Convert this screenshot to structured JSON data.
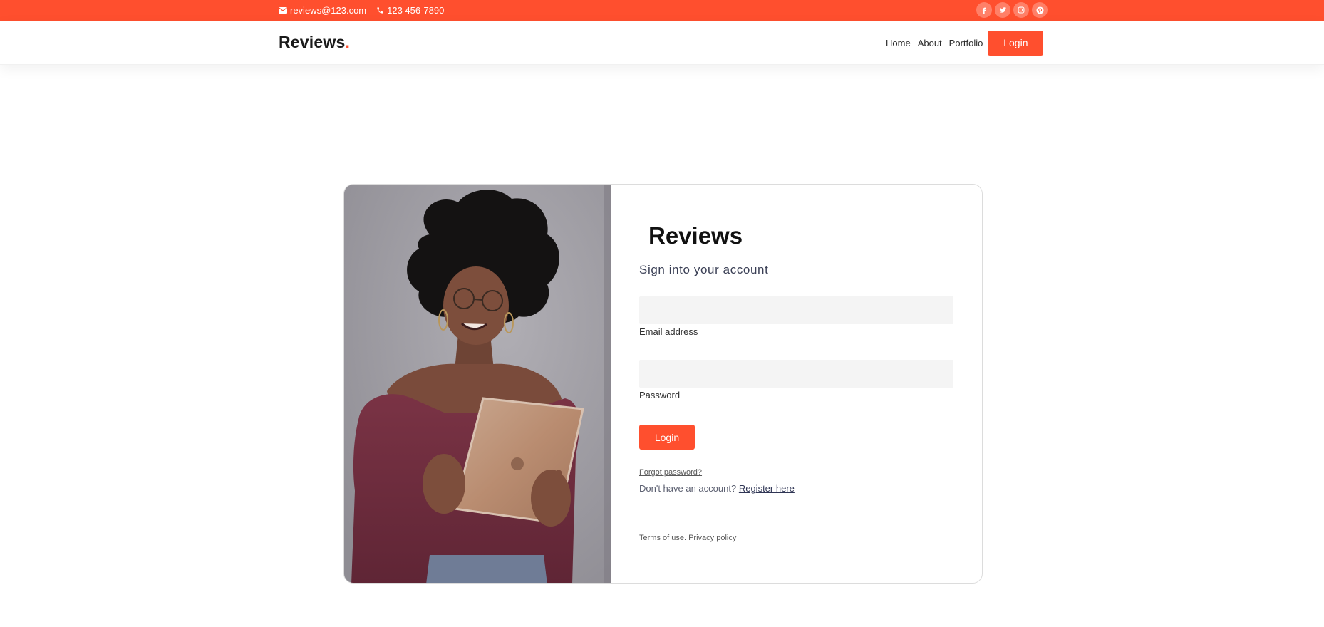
{
  "topbar": {
    "email": "reviews@123.com",
    "phone": "123 456-7890",
    "social": [
      {
        "name": "facebook-icon"
      },
      {
        "name": "twitter-icon"
      },
      {
        "name": "instagram-icon"
      },
      {
        "name": "pinterest-icon"
      }
    ]
  },
  "navbar": {
    "brand": "Reviews",
    "brand_dot": ".",
    "links": [
      "Home",
      "About",
      "Portfolio"
    ],
    "login_label": "Login"
  },
  "login_form": {
    "title": "Reviews",
    "subtitle": "Sign into your account",
    "email": {
      "value": "",
      "placeholder": "",
      "label": "Email address"
    },
    "password": {
      "value": "",
      "placeholder": "",
      "label": "Password"
    },
    "login_button": "Login",
    "forgot_password": "Forgot password?",
    "register_prompt": "Don't have an account?",
    "register_link": "Register here",
    "terms": "Terms of use.",
    "privacy": "Privacy policy"
  },
  "colors": {
    "accent": "#ff4f2e",
    "text_dark": "#111111",
    "subtitle": "#3a3f55",
    "input_bg": "#f4f4f4"
  }
}
